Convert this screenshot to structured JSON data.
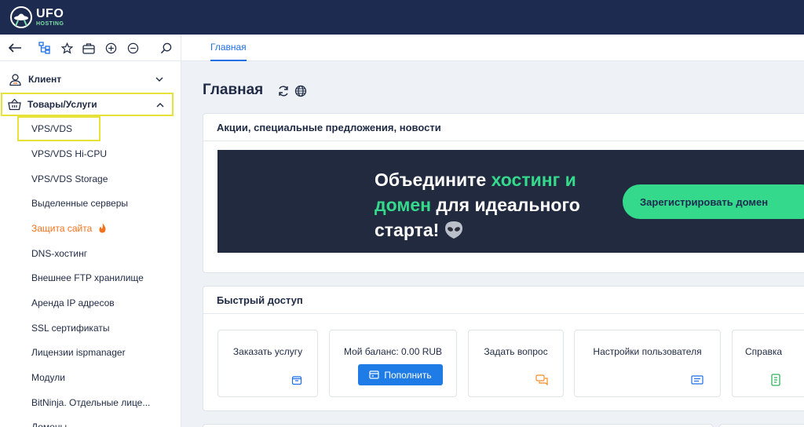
{
  "brand": {
    "name": "UFO",
    "sub": "HOSTING"
  },
  "colors": {
    "topbar": "#1c2b4f",
    "accent": "#1f6fe5",
    "highlight": "#e6e23a",
    "banner_bg": "#222a3f",
    "green": "#34d98c",
    "orange": "#f2731d"
  },
  "toolbar": {
    "icons": [
      "back-arrow-icon",
      "sitemap-icon",
      "star-icon",
      "briefcase-icon",
      "zoom-in-icon",
      "zoom-out-icon",
      "search-icon"
    ]
  },
  "tabs": [
    {
      "label": "Главная",
      "active": true
    }
  ],
  "sidebar": {
    "groups": [
      {
        "label": "Клиент",
        "icon": "user-icon",
        "expanded": false
      },
      {
        "label": "Товары/Услуги",
        "icon": "basket-icon",
        "expanded": true
      }
    ],
    "items": [
      {
        "label": "VPS/VDS"
      },
      {
        "label": "VPS/VDS Hi-CPU"
      },
      {
        "label": "VPS/VDS Storage"
      },
      {
        "label": "Выделенные серверы"
      },
      {
        "label": "Защита сайта"
      },
      {
        "label": "DNS-хостинг"
      },
      {
        "label": "Внешнее FTP хранилище"
      },
      {
        "label": "Аренда IP адресов"
      },
      {
        "label": "SSL сертификаты"
      },
      {
        "label": "Лицензии ispmanager"
      },
      {
        "label": "Модули"
      },
      {
        "label": "BitNinja. Отдельные лице..."
      },
      {
        "label": "Домены"
      }
    ]
  },
  "main": {
    "title": "Главная",
    "promo": {
      "header": "Акции, специальные предложения, новости",
      "line1_a": "Объедините ",
      "line1_b": "хостинг и",
      "line2_a": "домен",
      "line2_b": " для идеального",
      "line3": "старта!",
      "button": "Зарегистрировать домен"
    },
    "quick": {
      "header": "Быстрый доступ",
      "tiles": [
        {
          "label": "Заказать услугу",
          "icon": "box-icon"
        },
        {
          "label": "Мой баланс: 0.00 RUB",
          "button": "Пополнить",
          "icon": "wallet-icon"
        },
        {
          "label": "Задать вопрос",
          "icon": "chat-icon"
        },
        {
          "label": "Настройки пользователя",
          "icon": "settings-card-icon"
        },
        {
          "label": "Справка",
          "icon": "help-doc-icon"
        }
      ]
    }
  }
}
